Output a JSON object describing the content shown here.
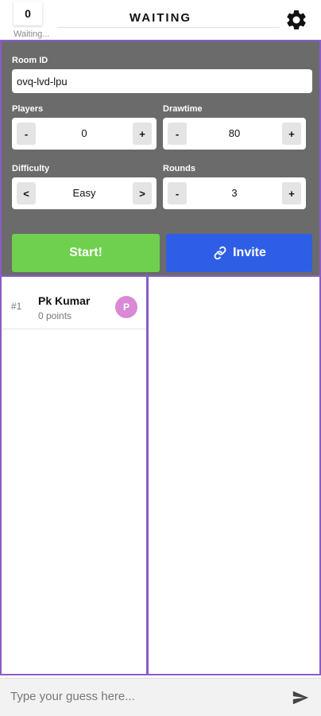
{
  "header": {
    "timer": "0",
    "status": "Waiting...",
    "title": "WAITING"
  },
  "settings": {
    "room_id_label": "Room ID",
    "room_id_value": "ovq-lvd-lpu",
    "players_label": "Players",
    "players_value": "0",
    "drawtime_label": "Drawtime",
    "drawtime_value": "80",
    "difficulty_label": "Difficulty",
    "difficulty_value": "Easy",
    "rounds_label": "Rounds",
    "rounds_value": "3",
    "minus": "-",
    "plus": "+",
    "prev": "<",
    "next": ">"
  },
  "actions": {
    "start_label": "Start!",
    "invite_label": "Invite"
  },
  "players": [
    {
      "rank": "#1",
      "name": "Pk Kumar",
      "points": "0 points",
      "avatar_letter": "P"
    }
  ],
  "guess": {
    "placeholder": "Type your guess here..."
  },
  "colors": {
    "panel": "#6b6b6b",
    "accent_border": "#8a5cc6",
    "start": "#6fd04f",
    "invite": "#2f5ee6",
    "avatar": "#d989d6"
  },
  "icons": {
    "settings": "gear-icon",
    "invite": "link-icon",
    "send": "send-icon"
  }
}
